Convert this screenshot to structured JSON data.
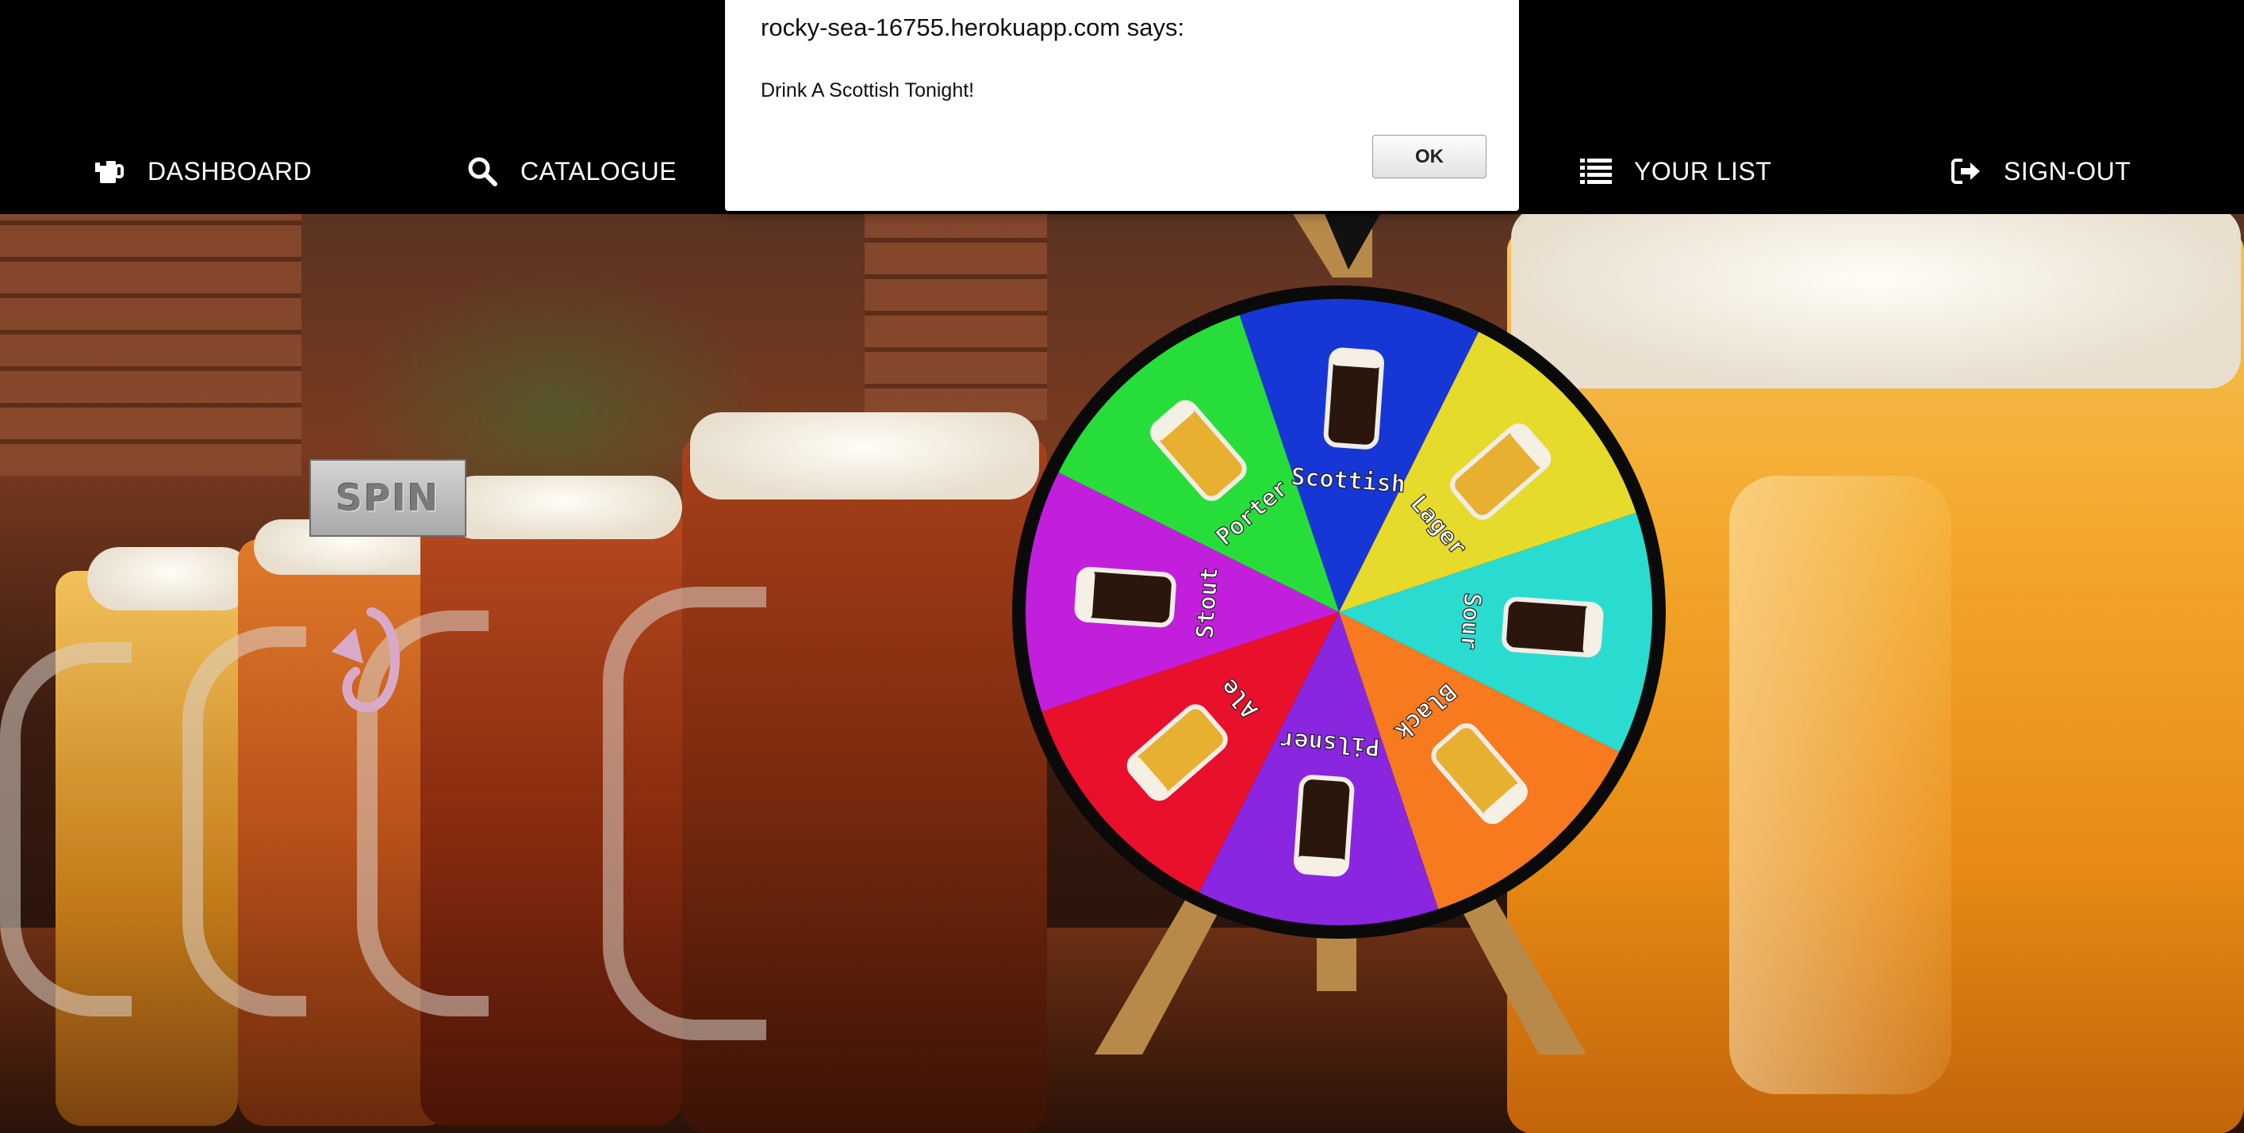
{
  "nav": {
    "dashboard_label": "DASHBOARD",
    "catalogue_label": "CATALOGUE",
    "your_list_label": "YOUR LIST",
    "sign_out_label": "SIGN-OUT"
  },
  "alert": {
    "title": "rocky-sea-16755.herokuapp.com says:",
    "message": "Drink A Scottish Tonight!",
    "ok_label": "OK"
  },
  "spin": {
    "label": "SPIN"
  },
  "wheel": {
    "segments": [
      {
        "label": "Scottish",
        "color": "#1637d6"
      },
      {
        "label": "Lager",
        "color": "#e6da2a"
      },
      {
        "label": "Sour",
        "color": "#2adcd0"
      },
      {
        "label": "Black",
        "color": "#f77a1f"
      },
      {
        "label": "Pilsner",
        "color": "#8a25e0"
      },
      {
        "label": "Ale",
        "color": "#e8102a"
      },
      {
        "label": "Stout",
        "color": "#c21fdc"
      },
      {
        "label": "Porter",
        "color": "#27dd3a"
      }
    ],
    "rim_color": "#0a0a0a",
    "stand_color": "#b88a4a"
  },
  "colors": {
    "navbar_bg": "#000000",
    "nav_text": "#ffffff"
  }
}
